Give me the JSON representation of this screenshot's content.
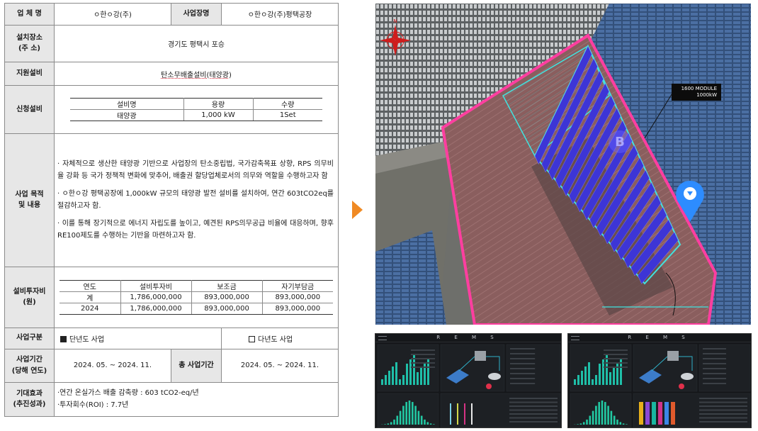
{
  "form": {
    "company_label": "업 체 명",
    "company_value": "ㅇ한ㅇ강(주)",
    "site_label": "사업장명",
    "site_value": "ㅇ한ㅇ강(주)평택공장",
    "location_label_1": "설치장소",
    "location_label_2": "(주  소)",
    "location_value": "경기도 평택시 포승",
    "support_label": "지원설비",
    "support_value": "탄소무배출설비(태양광)",
    "apply_label": "신청설비",
    "equipment": {
      "headers": [
        "설비명",
        "용량",
        "수량"
      ],
      "row": [
        "태양광",
        "1,000 kW",
        "1Set"
      ]
    },
    "purpose_label_1": "사업 목적",
    "purpose_label_2": "및 내용",
    "purpose_items": [
      "· 자체적으로 생산한 태양광 기반으로 사업장의 탄소중립법, 국가감축목표 상향, RPS 의무비율 강화 등 국가 정책적 변화에 맞추어, 배출권 할당업체로서의 의무와 역할을 수행하고자 함",
      "· ㅇ한ㅇ강 평택공장에 1,000kW 규모의 태양광 발전 설비를 설치하여, 연간 603tCO2eq를 절감하고자 함.",
      "· 이를 통해 장기적으로 에너지 자립도를 높이고, 예견된 RPS의무공급 비율에 대응하며, 향후 RE100제도를 수행하는 기반을 마련하고자 함."
    ],
    "invest_label_1": "설비투자비",
    "invest_label_2": "(원)",
    "invest": {
      "headers": [
        "연도",
        "설비투자비",
        "보조금",
        "자기부담금"
      ],
      "rows": [
        [
          "계",
          "1,786,000,000",
          "893,000,000",
          "893,000,000"
        ],
        [
          "2024",
          "1,786,000,000",
          "893,000,000",
          "893,000,000"
        ]
      ]
    },
    "type_label": "사업구분",
    "type_single": "단년도 사업",
    "type_multi": "다년도 사업",
    "period_label_1": "사업기간",
    "period_label_2": "(당해 연도)",
    "period_value": "2024. 05. ~ 2024. 11.",
    "total_period_label": "총 사업기간",
    "total_period_value": "2024. 05. ~ 2024. 11.",
    "effect_label_1": "기대효과",
    "effect_label_2": "(추진성과)",
    "effect_line_1": "·연간 온실가스 배출 감축량 : 603  tCO2-eq/년",
    "effect_line_2": "·투자회수(ROI) : 7.7년"
  },
  "map": {
    "label_line_1": "1600  MODULE",
    "label_line_2": "1000kW",
    "compass_letter": "N"
  },
  "dashboards": {
    "brand": "R E M S"
  },
  "colors": {
    "label_bg": "#e7e7e7",
    "arrow": "#f08a24",
    "roof_outline": "#ff3ea0",
    "panel_blue": "#3d35d6",
    "cyan_outline": "#3fe4e0",
    "pin_blue": "#2d8cff"
  }
}
